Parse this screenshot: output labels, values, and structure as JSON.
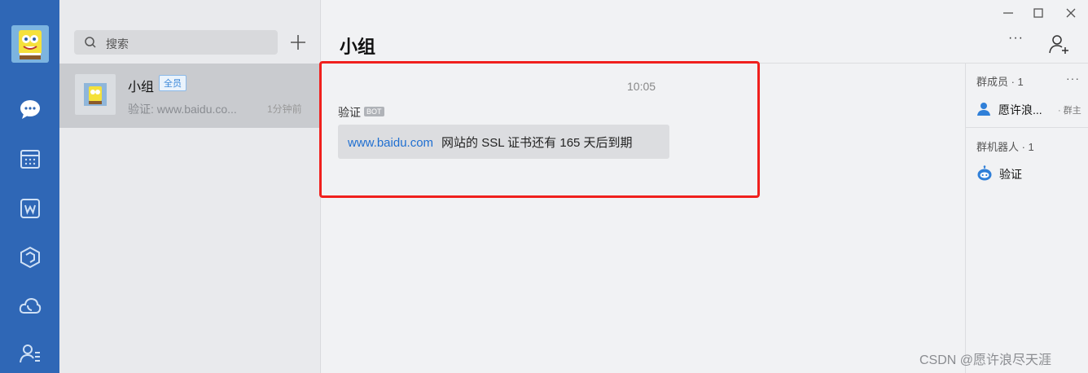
{
  "chat": {
    "title": "小组",
    "more_label": "···"
  },
  "conversation_list": {
    "search_placeholder": "搜索",
    "items": [
      {
        "name": "小组",
        "badge": "全员",
        "preview": "验证: www.baidu.co...",
        "time": "1分钟前"
      }
    ]
  },
  "message": {
    "time": "10:05",
    "sender": "验证",
    "sender_tag": "BOT",
    "link_text": "www.baidu.com",
    "text": "网站的 SSL 证书还有 165 天后到期"
  },
  "side_panel": {
    "members_header": "群成员 · 1",
    "more_label": "···",
    "members": [
      {
        "name": "愿许浪...",
        "role": "· 群主"
      }
    ],
    "robots_header": "群机器人 · 1",
    "robots": [
      {
        "name": "验证"
      }
    ]
  },
  "watermark": "CSDN @愿许浪尽天涯",
  "colors": {
    "rail": "#2f67b6",
    "link": "#1f6fd1",
    "highlight_border": "#f0201d",
    "member_icon": "#2f7fd8"
  },
  "icons": {
    "rail": [
      "chat-icon",
      "calendar-icon",
      "document-w-icon",
      "workbench-icon",
      "cloud-phone-icon",
      "contacts-icon"
    ]
  }
}
